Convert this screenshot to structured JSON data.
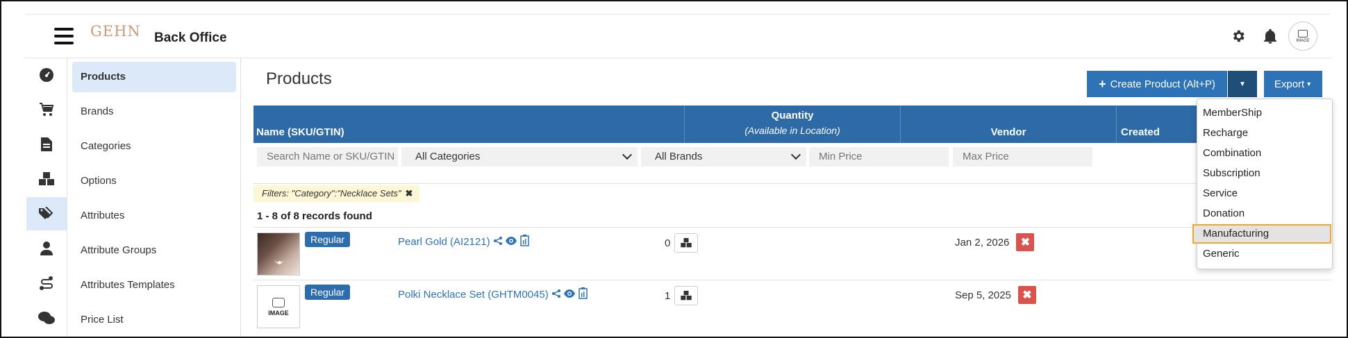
{
  "header": {
    "logo_text": "GEHN",
    "app_title": "Back Office",
    "avatar_text": "IMAGE"
  },
  "sidebar": {
    "items": [
      {
        "label": "Products",
        "active": true
      },
      {
        "label": "Brands"
      },
      {
        "label": "Categories"
      },
      {
        "label": "Options"
      },
      {
        "label": "Attributes"
      },
      {
        "label": "Attribute Groups"
      },
      {
        "label": "Attributes Templates"
      },
      {
        "label": "Price List"
      }
    ],
    "icons": [
      "dashboard-icon",
      "cart-icon",
      "document-icon",
      "boxes-icon",
      "tags-icon",
      "user-icon",
      "route-icon",
      "chat-icon"
    ]
  },
  "page": {
    "title": "Products",
    "create_button": "Create Product (Alt+P)",
    "export_button": "Export"
  },
  "table": {
    "columns": {
      "name": "Name (SKU/GTIN)",
      "quantity": "Quantity",
      "quantity_sub": "(Available in Location)",
      "vendor": "Vendor",
      "created": "Created"
    },
    "filters": {
      "search_placeholder": "Search Name or SKU/GTIN",
      "category_value": "All Categories",
      "brand_value": "All Brands",
      "min_price_placeholder": "Min Price",
      "max_price_placeholder": "Max Price"
    },
    "active_filter": "Filters: \"Category\":\"Necklace Sets\"",
    "records_found": "1 - 8 of 8 records found",
    "rows": [
      {
        "badge": "Regular",
        "name": "Pearl Gold (AI2121)",
        "qty": "0",
        "created": "Jan 2, 2026"
      },
      {
        "badge": "Regular",
        "name": "Polki Necklace Set (GHTM0045)",
        "qty": "1",
        "created": "Sep 5, 2025",
        "image_label": "IMAGE"
      }
    ]
  },
  "create_dropdown": {
    "items": [
      "MemberShip",
      "Recharge",
      "Combination",
      "Subscription",
      "Service",
      "Donation",
      "Manufacturing",
      "Generic"
    ],
    "highlighted": "Manufacturing"
  },
  "colors": {
    "primary": "#2e73b5",
    "table_header": "#2d6aa6",
    "danger": "#d9534f",
    "active_nav": "#dbe9f8",
    "highlight_border": "#f5a623"
  }
}
